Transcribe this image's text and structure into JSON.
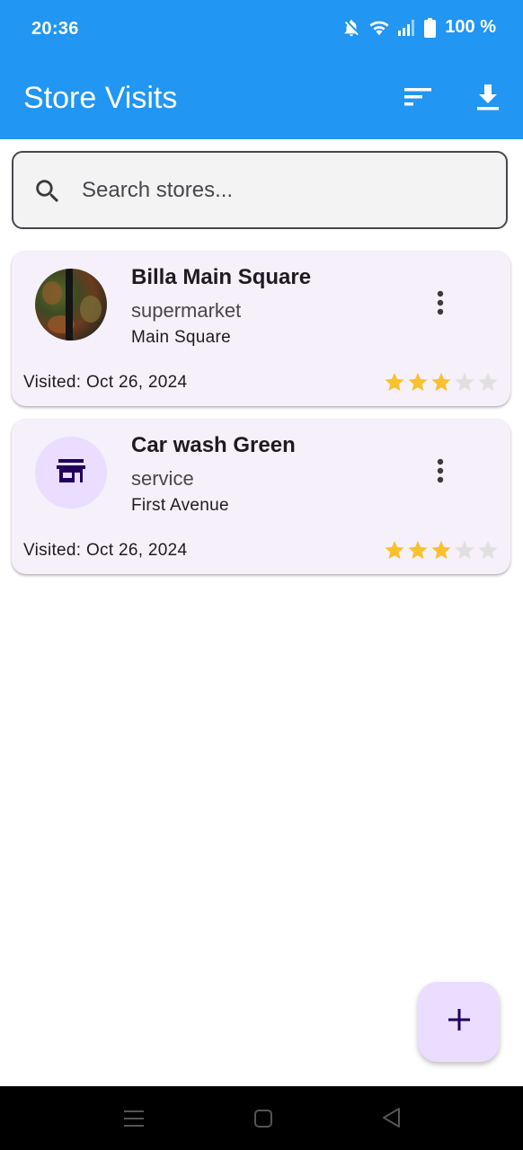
{
  "status_bar": {
    "time": "20:36",
    "battery_text": "100 %",
    "icons": [
      "bell-off-icon",
      "wifi-icon",
      "signal-icon",
      "battery-icon"
    ]
  },
  "app_bar": {
    "title": "Store Visits",
    "actions": [
      "sort-icon",
      "download-icon"
    ]
  },
  "search": {
    "placeholder": "Search stores...",
    "value": ""
  },
  "stores": [
    {
      "name": "Billa Main Square",
      "category": "supermarket",
      "address": "Main Square",
      "visited": "Visited: Oct 26, 2024",
      "rating": 3,
      "rating_max": 5,
      "thumbnail": "photo"
    },
    {
      "name": "Car wash Green",
      "category": "service",
      "address": "First Avenue",
      "visited": "Visited: Oct 26, 2024",
      "rating": 3,
      "rating_max": 5,
      "thumbnail": "storefront-icon"
    }
  ],
  "fab": {
    "icon": "plus-icon"
  },
  "colors": {
    "app_bar": "#2196f3",
    "card_bg": "#f5f0f9",
    "avatar_bg": "#eaddff",
    "star_filled": "#fbc02d",
    "star_empty": "#e0e0e0",
    "icon_dark": "#21005d"
  },
  "nav_bar": {
    "icons": [
      "menu-icon",
      "home-square-icon",
      "back-triangle-icon"
    ]
  }
}
